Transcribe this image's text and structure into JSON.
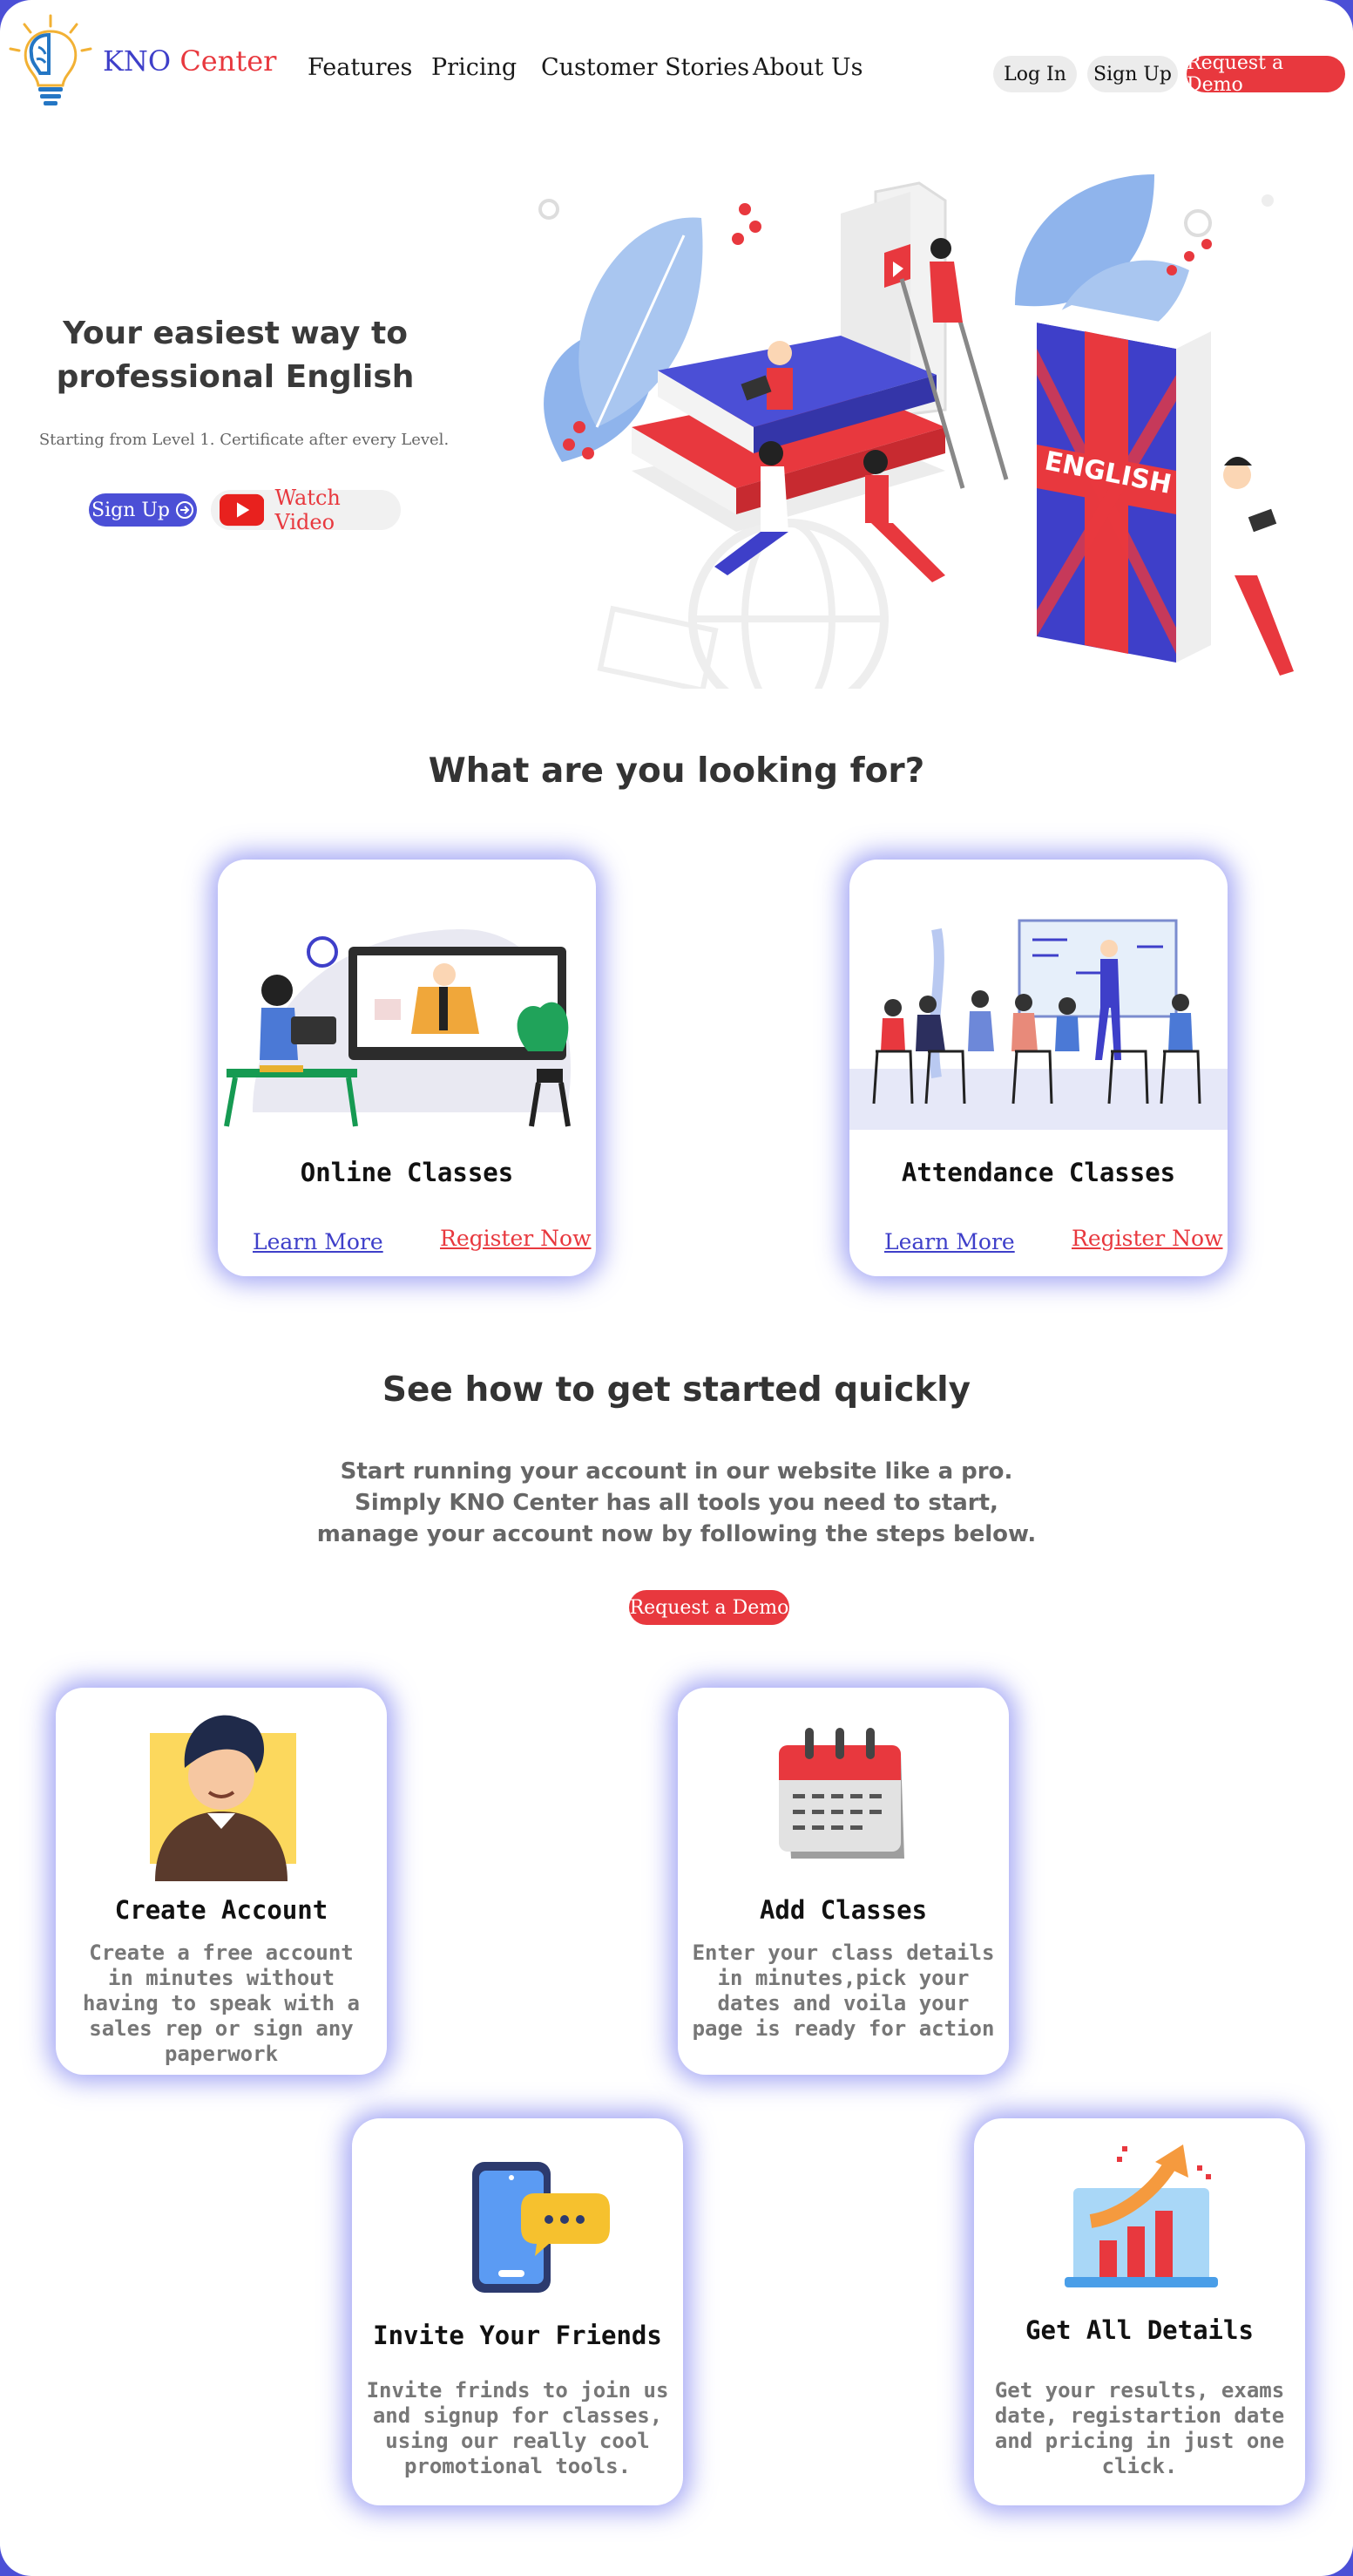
{
  "nav": {
    "brand_kno": "KNO",
    "brand_center": "Center",
    "links": [
      "Features",
      "Pricing",
      "Customer Stories",
      "About Us"
    ],
    "login": "Log In",
    "signup": "Sign Up",
    "request_demo": "Request a Demo"
  },
  "hero": {
    "title_line1": "Your easiest way to",
    "title_line2": "professional English",
    "subtitle": "Starting from Level 1. Certificate after every Level.",
    "signup_button": "Sign Up",
    "watch_video": "Watch Video",
    "book_label": "ENGLISH"
  },
  "looking_for": {
    "heading": "What are you looking for?",
    "cards": [
      {
        "title": "Online Classes",
        "learn_more": "Learn More",
        "register": "Register Now"
      },
      {
        "title": "Attendance Classes",
        "learn_more": "Learn More",
        "register": "Register Now"
      }
    ]
  },
  "get_started": {
    "heading": "See how to get started quickly",
    "line1": "Start running your account in our website like a pro.",
    "line2": "Simply KNO Center has all tools you need to start,",
    "line3": "manage your account now by following the steps below.",
    "demo_button": "Request a Demo"
  },
  "steps": [
    {
      "title": "Create Account",
      "lines": [
        "Create a free account",
        "in minutes without",
        "having  to speak with a",
        "sales rep or sign any",
        "paperwork"
      ]
    },
    {
      "title": "Add Classes",
      "lines": [
        "Enter your class details",
        "in minutes,pick your",
        "dates and voila your",
        "page is ready for action"
      ]
    },
    {
      "title": "Invite Your Friends",
      "lines": [
        "Invite frinds to join us",
        "and signup for classes,",
        "using our really cool",
        "promotional tools."
      ]
    },
    {
      "title": "Get All Details",
      "lines": [
        "Get your results, exams",
        "date, registartion date",
        "and pricing in just one",
        "click."
      ]
    }
  ],
  "colors": {
    "primary": "#4b4fd6",
    "accent": "#e8383e",
    "text": "#333333"
  }
}
